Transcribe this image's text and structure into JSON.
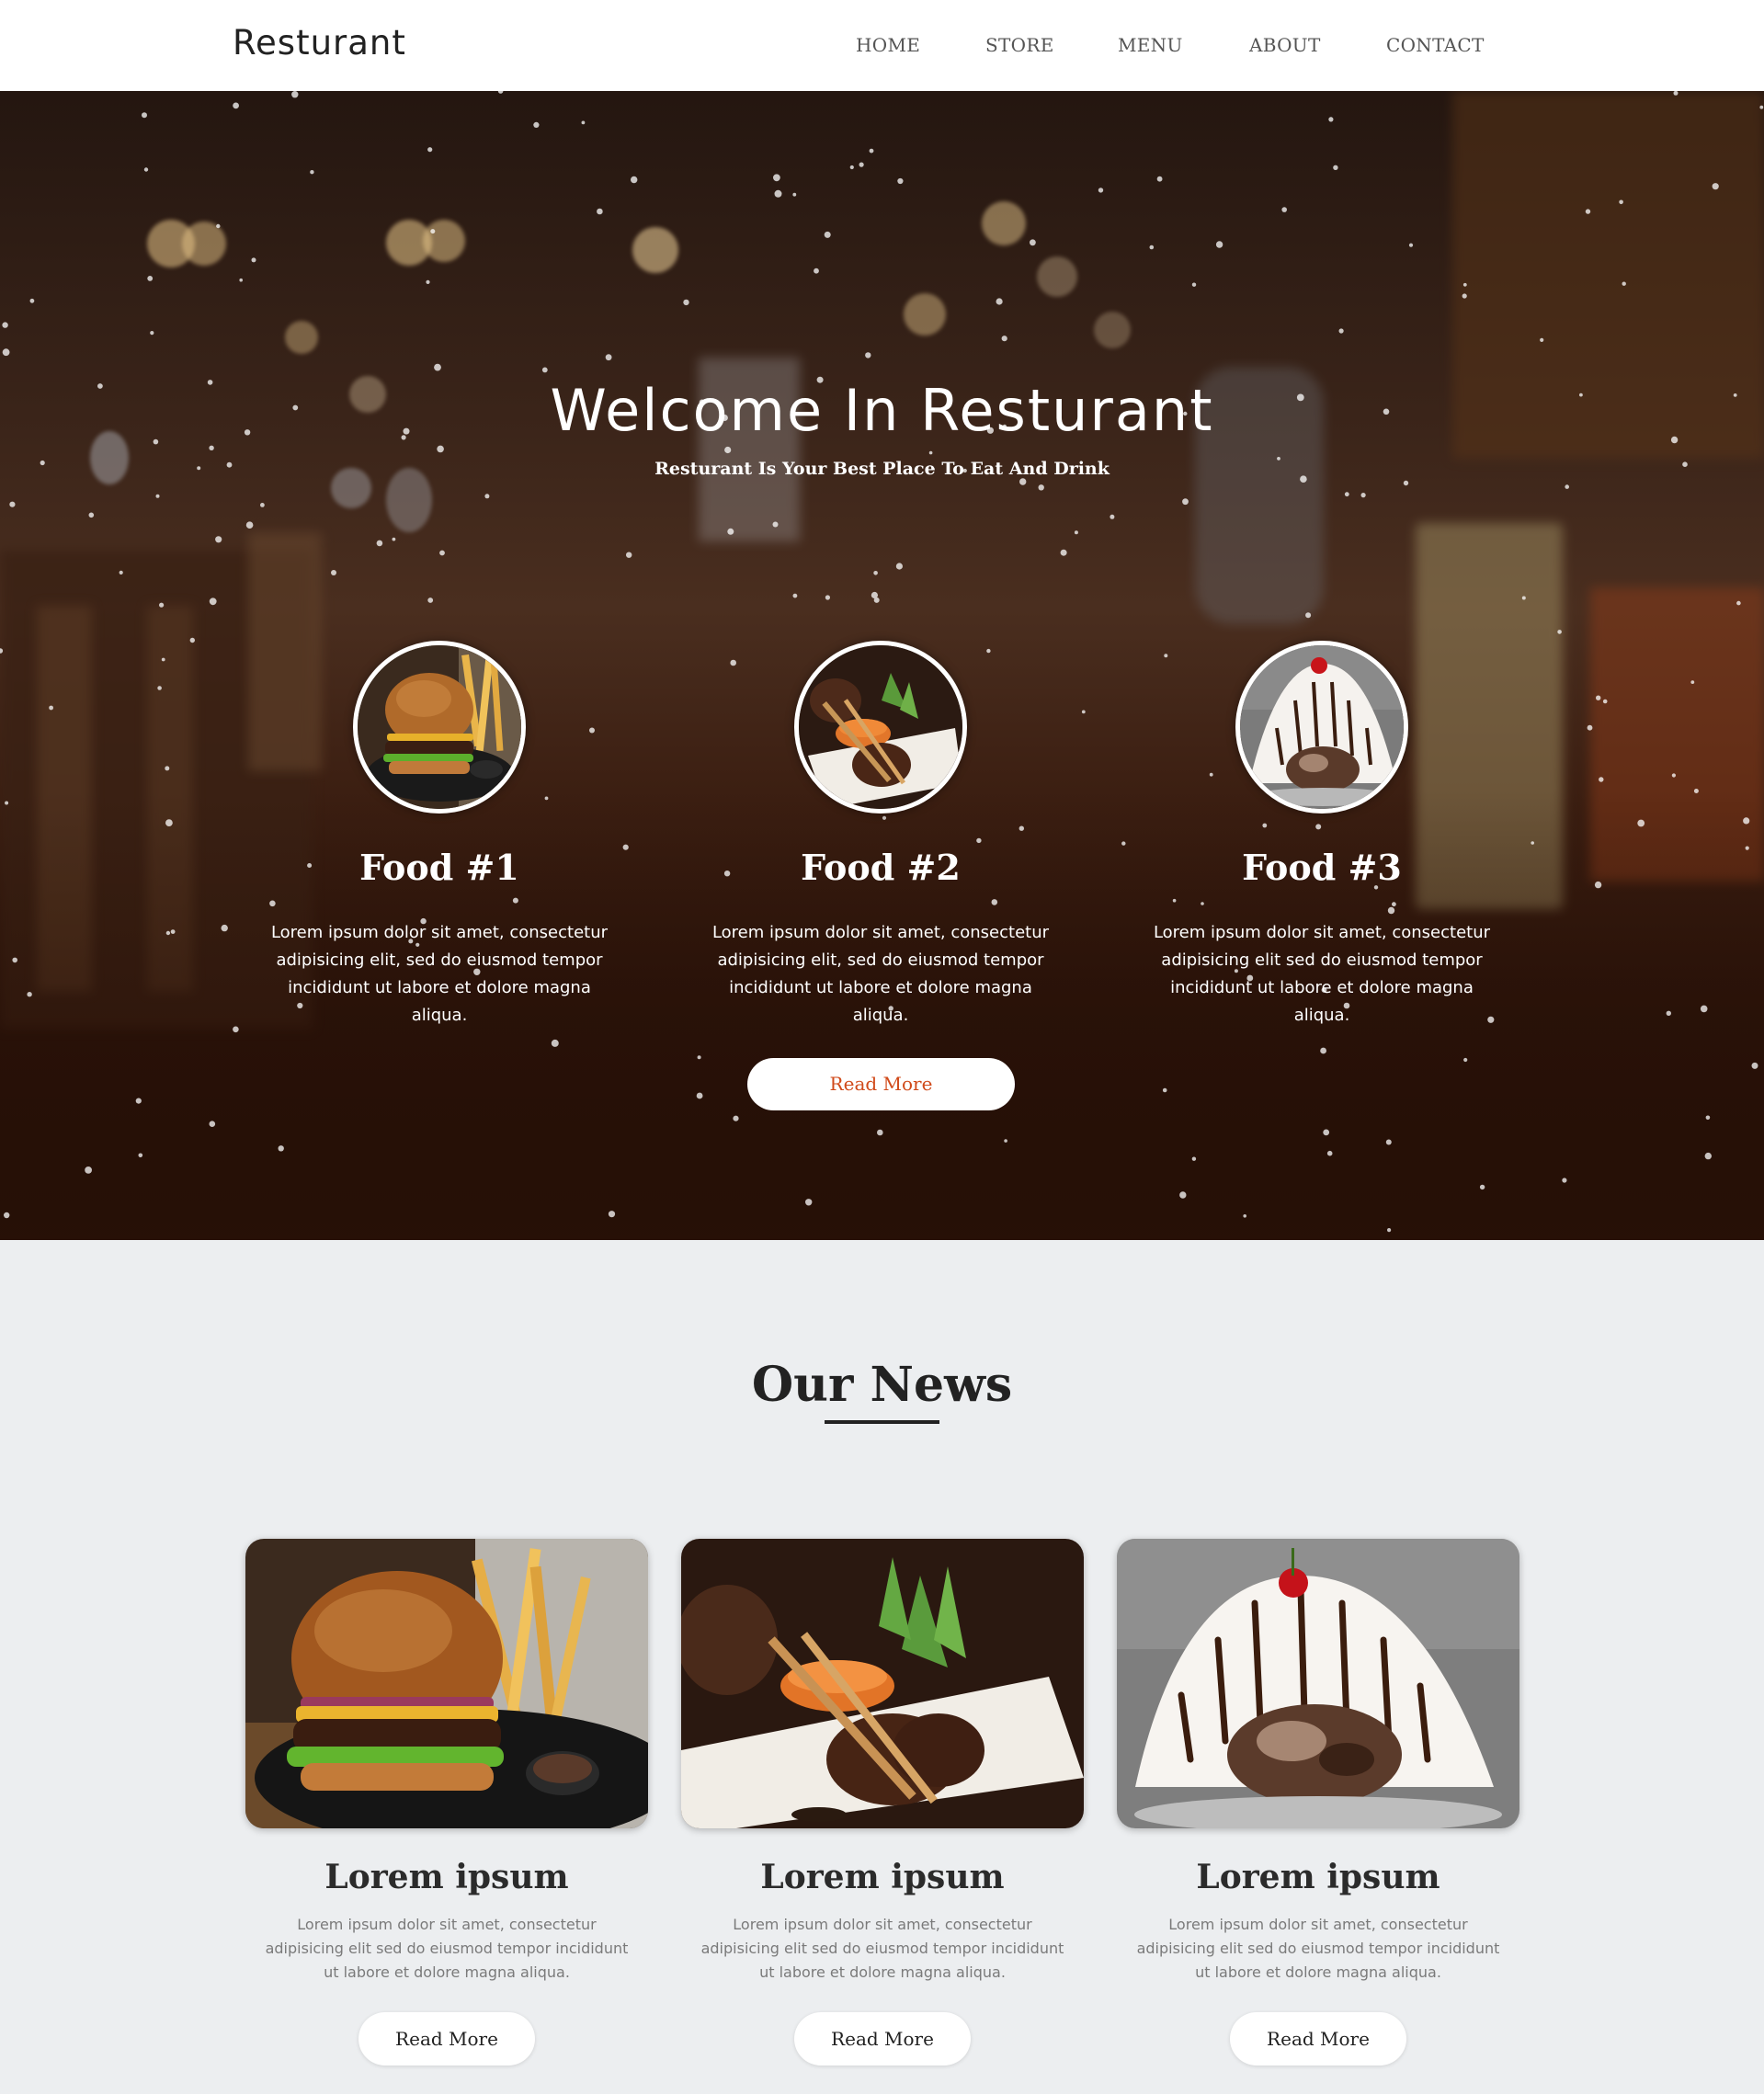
{
  "header": {
    "logo": "Resturant",
    "nav": [
      "HOME",
      "STORE",
      "MENU",
      "ABOUT",
      "CONTACT"
    ]
  },
  "hero": {
    "title": "Welcome In Resturant",
    "subtitle": "Resturant Is Your Best Place To Eat And Drink",
    "foods": [
      {
        "title": "Food #1",
        "text": "Lorem ipsum dolor sit amet, consectetur adipisicing elit, sed do eiusmod tempor incididunt ut labore et dolore magna aliqua.",
        "image": "burger"
      },
      {
        "title": "Food #2",
        "text": "Lorem ipsum dolor sit amet, consectetur adipisicing elit, sed do eiusmod tempor incididunt ut labore et dolore magna aliqua.",
        "image": "lamb-chops"
      },
      {
        "title": "Food #3",
        "text": "Lorem ipsum dolor sit amet, consectetur adipisicing elit sed do eiusmod tempor incididunt ut labore et dolore magna aliqua.",
        "image": "ice-cream-sundae"
      }
    ],
    "button": "Read More"
  },
  "news": {
    "title": "Our News",
    "items": [
      {
        "title": "Lorem ipsum",
        "text": "Lorem ipsum dolor sit amet, consectetur adipisicing elit sed do eiusmod tempor incididunt ut labore et dolore magna aliqua.",
        "button": "Read More",
        "image": "burger"
      },
      {
        "title": "Lorem ipsum",
        "text": "Lorem ipsum dolor sit amet, consectetur adipisicing elit sed do eiusmod tempor incididunt ut labore et dolore magna aliqua.",
        "button": "Read More",
        "image": "lamb-chops"
      },
      {
        "title": "Lorem ipsum",
        "text": "Lorem ipsum dolor sit amet, consectetur adipisicing elit sed do eiusmod tempor incididunt ut labore et dolore magna aliqua.",
        "button": "Read More",
        "image": "ice-cream-sundae"
      }
    ]
  },
  "colors": {
    "accent": "#d04a1a",
    "hero_dark": "#2a130a",
    "page_bg": "#eceef0"
  }
}
